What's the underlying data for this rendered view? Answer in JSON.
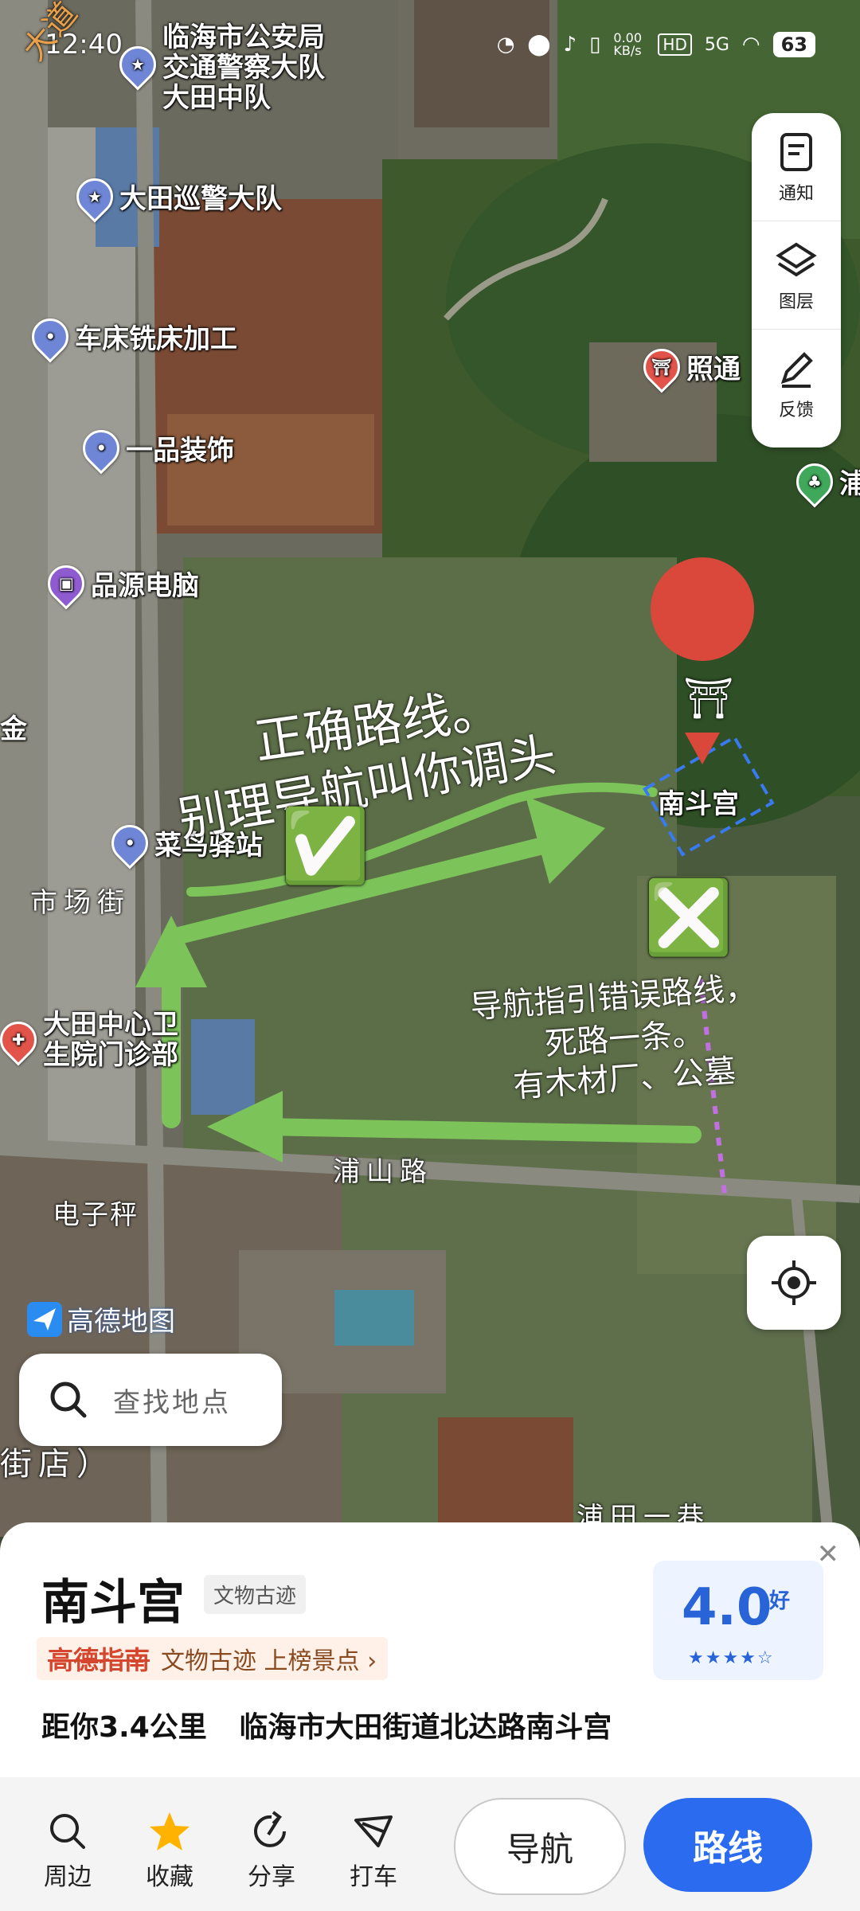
{
  "status": {
    "time": "12:40",
    "net_speed": "0.00 KB/s",
    "hd": "HD",
    "signal": "5G",
    "battery": "63"
  },
  "corner_text": "大道",
  "pois": [
    {
      "name": "临海市公安局\n交通警察大队\n大田中队",
      "icon": "star-icon",
      "color": "#6f86d6"
    },
    {
      "name": "大田巡警大队",
      "icon": "star-icon",
      "color": "#6f86d6"
    },
    {
      "name": "车床铣床加工",
      "icon": "pin-icon",
      "color": "#6f86d6"
    },
    {
      "name": "一品装饰",
      "icon": "pin-icon",
      "color": "#6f86d6"
    },
    {
      "name": "品源电脑",
      "icon": "shop-icon",
      "color": "#8e5bd0"
    },
    {
      "name": "菜鸟驿站",
      "icon": "pin-icon",
      "color": "#6f86d6"
    },
    {
      "name": "大田中心卫\n生院门诊部",
      "icon": "medical-icon",
      "color": "#e2544a"
    },
    {
      "name": "照通",
      "icon": "temple-icon",
      "color": "#e2544a"
    },
    {
      "name": "浦",
      "icon": "tree-icon",
      "color": "#3fa85b"
    },
    {
      "name": "金",
      "icon": "",
      "color": ""
    },
    {
      "name": "南斗宫",
      "icon": "temple-icon",
      "color": "#d9483b"
    }
  ],
  "roads": [
    "市场街",
    "浦山路",
    "电子秤",
    "浦田一巷",
    "街店）"
  ],
  "annotations": {
    "correct": [
      "正确路线。",
      "别理导航叫你调头"
    ],
    "wrong": [
      "导航指引错误路线，",
      "死路一条。",
      "有木材厂、公墓"
    ],
    "check": "✅",
    "cross": "❎"
  },
  "side": {
    "notice": "通知",
    "layers": "图层",
    "feedback": "反馈"
  },
  "logo": "高德地图",
  "search": {
    "placeholder": "查找地点"
  },
  "place": {
    "name": "南斗宫",
    "category": "文物古迹",
    "guide_brand": "高德指南",
    "guide_text": "文物古迹 上榜景点 ›",
    "distance": "距你3.4公里",
    "address": "临海市大田街道北达路南斗宫",
    "rating": "4.0",
    "rating_label": "好",
    "stars": "★★★★☆"
  },
  "bottom": {
    "around": "周边",
    "favorite": "收藏",
    "share": "分享",
    "taxi": "打车",
    "navigate": "导航",
    "route": "路线"
  },
  "colors": {
    "accent": "#2a6bf0",
    "arrow": "#7cc35a",
    "map_base": "#3c4a35"
  }
}
